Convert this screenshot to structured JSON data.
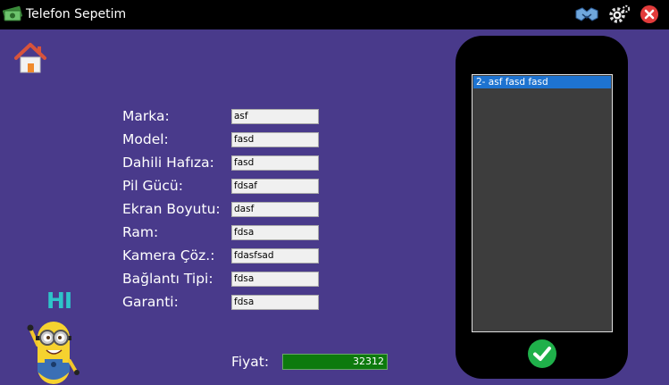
{
  "window": {
    "title": "Telefon Sepetim",
    "icons": [
      "app-money-icon",
      "handshake-icon",
      "gear-icon",
      "close-icon"
    ]
  },
  "form": {
    "fields": [
      {
        "label": "Marka:",
        "value": "asf"
      },
      {
        "label": "Model:",
        "value": "fasd"
      },
      {
        "label": "Dahili Hafıza:",
        "value": "fasd"
      },
      {
        "label": "Pil Gücü:",
        "value": "fdsaf"
      },
      {
        "label": "Ekran Boyutu:",
        "value": "dasf"
      },
      {
        "label": "Ram:",
        "value": "fdsa"
      },
      {
        "label": "Kamera Çöz.:",
        "value": "fdasfsad"
      },
      {
        "label": "Bağlantı Tipi:",
        "value": "fdsa"
      },
      {
        "label": "Garanti:",
        "value": "fdsa"
      }
    ]
  },
  "price": {
    "label": "Fiyat:",
    "value": "32312"
  },
  "phone": {
    "list": [
      "2- asf fasd fasd"
    ]
  },
  "mascot": {
    "greeting": "HI"
  },
  "colors": {
    "background": "#493a8b",
    "titlebar": "#000000",
    "price_bar": "#0d7a0d",
    "selection": "#1e73d0",
    "confirm": "#1fb04a"
  }
}
